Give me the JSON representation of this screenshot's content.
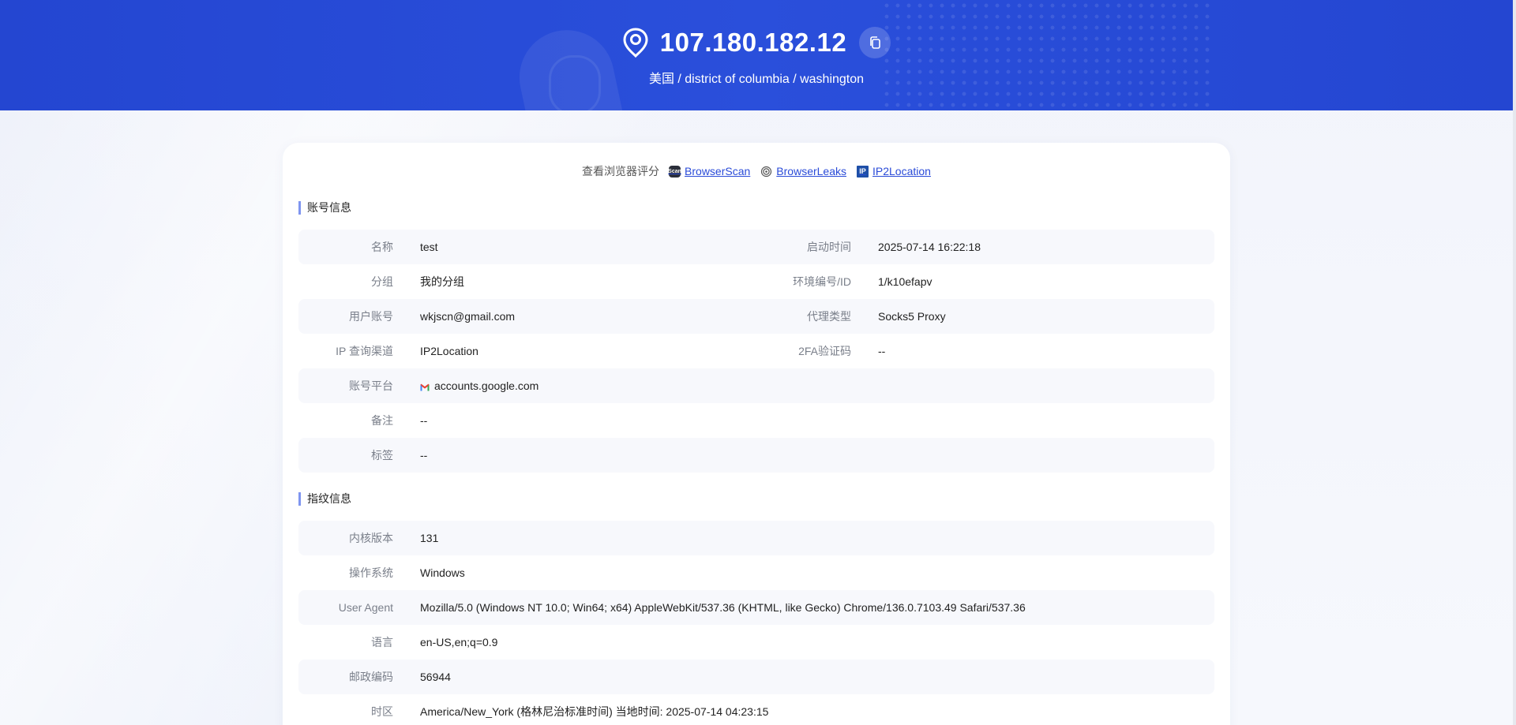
{
  "header": {
    "ip": "107.180.182.12",
    "location": "美国 / district of columbia / washington",
    "pin_icon": "location-pin-icon",
    "copy_icon": "copy-icon"
  },
  "browser_score": {
    "label": "查看浏览器评分",
    "links": [
      {
        "text": "BrowserScan",
        "icon": "browserscan-logo-icon"
      },
      {
        "text": "BrowserLeaks",
        "icon": "fingerprint-icon"
      },
      {
        "text": "IP2Location",
        "icon": "ip2location-logo-icon"
      }
    ]
  },
  "account": {
    "title": "账号信息",
    "rows": [
      {
        "label": "名称",
        "value": "test",
        "label2": "启动时间",
        "value2": "2025-07-14 16:22:18"
      },
      {
        "label": "分组",
        "value": "我的分组",
        "label2": "环境编号/ID",
        "value2": "1/k10efapv"
      },
      {
        "label": "用户账号",
        "value": "wkjscn@gmail.com",
        "label2": "代理类型",
        "value2": "Socks5 Proxy"
      },
      {
        "label": "IP 查询渠道",
        "value": "IP2Location",
        "label2": "2FA验证码",
        "value2": "--"
      },
      {
        "label": "账号平台",
        "value": "accounts.google.com"
      },
      {
        "label": "备注",
        "value": "--"
      },
      {
        "label": "标签",
        "value": "--"
      }
    ]
  },
  "fingerprint": {
    "title": "指纹信息",
    "rows": [
      {
        "label": "内核版本",
        "value": "131"
      },
      {
        "label": "操作系统",
        "value": "Windows"
      },
      {
        "label": "User Agent",
        "value": "Mozilla/5.0 (Windows NT 10.0; Win64; x64) AppleWebKit/537.36 (KHTML, like Gecko) Chrome/136.0.7103.49 Safari/537.36"
      },
      {
        "label": "语言",
        "value": "en-US,en;q=0.9"
      },
      {
        "label": "邮政编码",
        "value": "56944"
      },
      {
        "label": "时区",
        "value": "America/New_York (格林尼治标准时间) 当地时间: 2025-07-14 04:23:15"
      }
    ]
  },
  "colors": {
    "header_blue": "#2446d1",
    "link_blue": "#2a4bd8",
    "section_accent": "#7f95f0"
  }
}
